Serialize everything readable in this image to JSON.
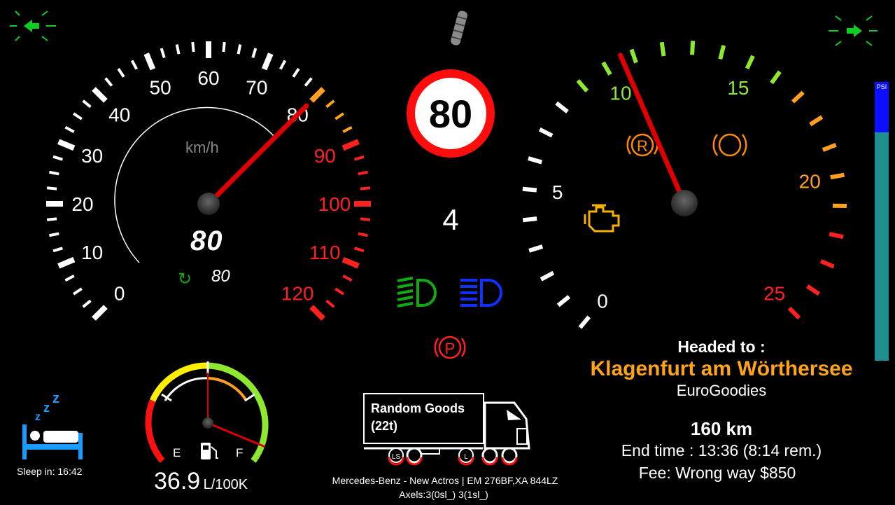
{
  "speedometer": {
    "unit": "km/h",
    "tick_labels": [
      "0",
      "10",
      "20",
      "30",
      "40",
      "50",
      "60",
      "70",
      "80",
      "90",
      "100",
      "110",
      "120"
    ],
    "max": 120,
    "speed": 80,
    "digital_speed": "80",
    "cruise_speed": "80"
  },
  "speed_limit": {
    "value": "80"
  },
  "gear": {
    "value": "4"
  },
  "tachometer": {
    "tick_labels": [
      "0",
      "5",
      "10",
      "15",
      "20",
      "25"
    ],
    "max": 25,
    "rpm_x100": 10.6
  },
  "fuel": {
    "empty_label": "E",
    "full_label": "F",
    "consumption_value": "36.9",
    "consumption_unit": "L/100K",
    "level_fraction": 0.95,
    "range_fraction": 0.5
  },
  "air_pressure": {
    "label": "PSI",
    "fraction": 0.18
  },
  "sleep": {
    "label": "Sleep in: 16:42"
  },
  "cargo": {
    "name": "Random Goods",
    "weight": "(22t)",
    "truck": "Mercedes-Benz - New Actros | EM 276BF,XA 844LZ",
    "axles": "Axels:3(0sl_) 3(1sl_)",
    "axle_markers": [
      "LS",
      "L"
    ]
  },
  "navigation": {
    "heading_label": "Headed to :",
    "destination": "Klagenfurt am Wörthersee",
    "company": "EuroGoodies",
    "distance": "160 km",
    "end_time": "End time : 13:36 (8:14 rem.)",
    "fee": "Fee: Wrong way $850"
  },
  "indicators": {
    "retarder_letter": "R",
    "parking_letter": "P"
  },
  "colors": {
    "needle": "#dd0000",
    "red_zone": "#ff2020",
    "orange_zone": "#ffa020",
    "green_zone": "#8ee830",
    "destination": "#ffa318",
    "low_beam": "#11aa11",
    "high_beam": "#1030ff",
    "warning": "#ff8a00",
    "turn_signal": "#11cc22"
  }
}
